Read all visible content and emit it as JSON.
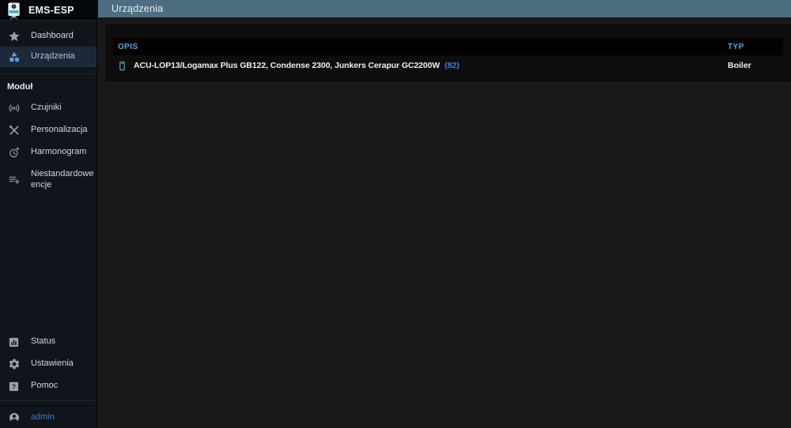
{
  "app": {
    "title": "EMS-ESP"
  },
  "header": {
    "title": "Urządzenia"
  },
  "sidebar": {
    "main_items": [
      {
        "label": "Dashboard",
        "icon": "star-icon",
        "selected": false
      },
      {
        "label": "Urządzenia",
        "icon": "category-icon",
        "selected": true
      }
    ],
    "section_label": "Moduł",
    "module_items": [
      {
        "label": "Czujniki",
        "icon": "sensors-icon"
      },
      {
        "label": "Personalizacja",
        "icon": "tools-icon"
      },
      {
        "label": "Harmonogram",
        "icon": "clock-plus-icon"
      },
      {
        "label": "Niestandardowe encje",
        "icon": "playlist-add-icon"
      }
    ],
    "bottom_items": [
      {
        "label": "Status",
        "icon": "bar-chart-icon"
      },
      {
        "label": "Ustawienia",
        "icon": "gear-icon"
      },
      {
        "label": "Pomoc",
        "icon": "question-icon"
      }
    ],
    "user": {
      "label": "admin",
      "icon": "account-circle-icon"
    }
  },
  "table": {
    "columns": [
      "OPIS",
      "TYP"
    ],
    "rows": [
      {
        "opis": "ACU-LOP13/Logamax Plus GB122, Condense 2300, Junkers Cerapur GC2200W",
        "count": "(82)",
        "typ": "Boiler",
        "icon": "thermostat-icon"
      }
    ]
  },
  "icons": {
    "logo": "gateway-device-logo",
    "help_glyph": "?"
  },
  "colors": {
    "appbar_bg": "#4d6e80",
    "sidebar_bg": "#10151b",
    "selected_item_bg": "#1d2938",
    "accent_blue": "#5b9fe3",
    "column_header_text": "#5da2e0",
    "count_link": "#3b7de0",
    "admin_link": "#3f78d1",
    "device_icon": "#79bfd3",
    "panel_bg": "#0d0d0d",
    "table_header_bg": "#020202"
  }
}
